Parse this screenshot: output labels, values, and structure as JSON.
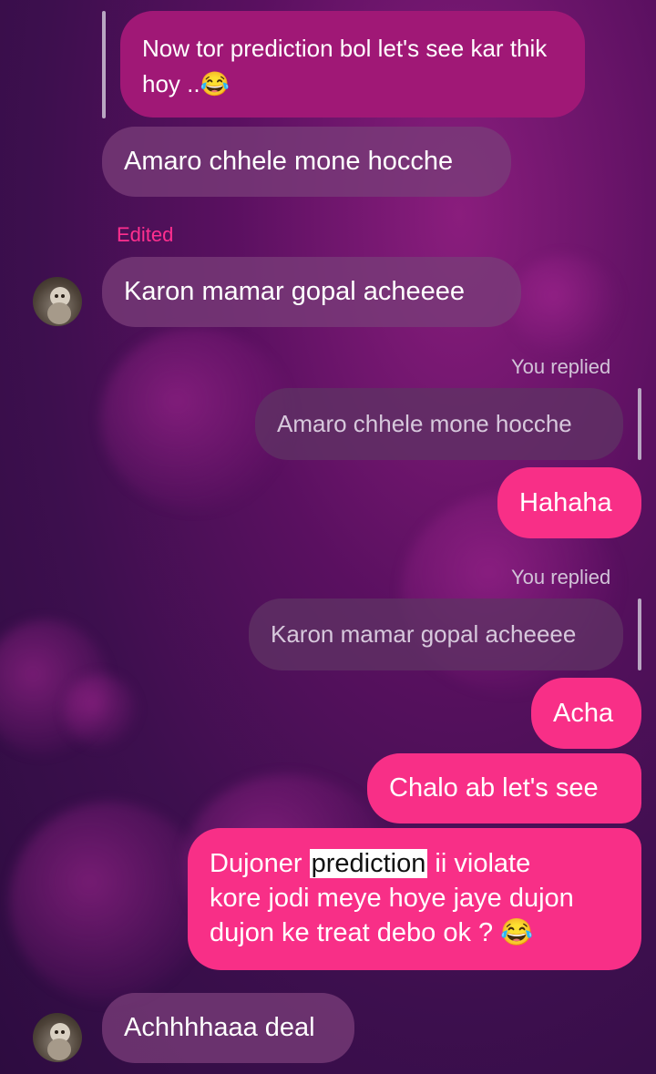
{
  "messages": {
    "quoted_top": "Now tor prediction bol let's see kar thik hoy ..😂",
    "m1": "Amaro chhele mone hocche",
    "edited_label": "Edited",
    "m2": "Karon mamar gopal acheeee",
    "reply1_label": "You replied",
    "reply1_quote": "Amaro chhele mone hocche",
    "reply1_text": "Hahaha",
    "reply2_label": "You replied",
    "reply2_quote": "Karon mamar gopal acheeee",
    "reply2_text": "Acha",
    "m3": "Chalo ab let's see",
    "m4_part1": "Dujoner ",
    "m4_highlight": "prediction",
    "m4_part2": " ii violate",
    "m4_line2": "kore jodi meye hoye jaye dujon",
    "m4_line3": "dujon ke treat debo ok ? 😂",
    "m5": "Achhhhaaa deal"
  },
  "colors": {
    "outgoing_bubble": "#f82f87",
    "incoming_bubble": "#78387a",
    "edited_label": "#ff2f8f"
  },
  "icons": {
    "avatar": "contact-avatar"
  }
}
